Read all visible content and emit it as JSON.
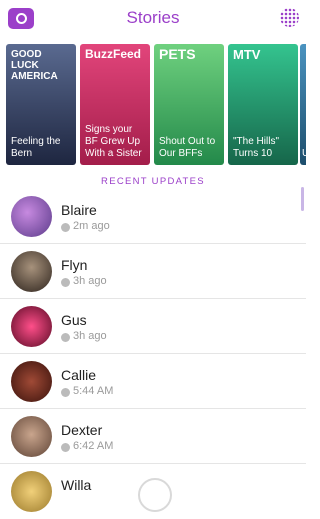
{
  "header": {
    "title": "Stories",
    "camera_icon": "camera-icon",
    "grid_icon": "discover-grid-icon",
    "accent": "#9b3fc9"
  },
  "cards": [
    {
      "logo": "GOOD LUCK AMERICA",
      "caption": "Feeling the Bern",
      "color": "#3c4b73"
    },
    {
      "logo": "BuzzFeed",
      "caption": "Signs your BF Grew Up With a Sister",
      "color": "#d7346d"
    },
    {
      "logo": "PETS",
      "caption": "Shout Out to Our BFFs",
      "color": "#3fb46a"
    },
    {
      "logo": "MTV",
      "caption": "\"The Hills\" Turns 10",
      "color": "#2aa17a"
    },
    {
      "logo": "",
      "caption": "U",
      "color": "#3a7ea7"
    }
  ],
  "section_label": "RECENT UPDATES",
  "updates": [
    {
      "name": "Blaire",
      "time": "2m ago",
      "color": "#7a4fa8"
    },
    {
      "name": "Flyn",
      "time": "3h ago",
      "color": "#5b4a3f"
    },
    {
      "name": "Gus",
      "time": "3h ago",
      "color": "#c0165a"
    },
    {
      "name": "Callie",
      "time": "5:44 AM",
      "color": "#6e2c22"
    },
    {
      "name": "Dexter",
      "time": "6:42 AM",
      "color": "#8d6b58"
    },
    {
      "name": "Willa",
      "time": "",
      "color": "#d8b35f"
    }
  ]
}
